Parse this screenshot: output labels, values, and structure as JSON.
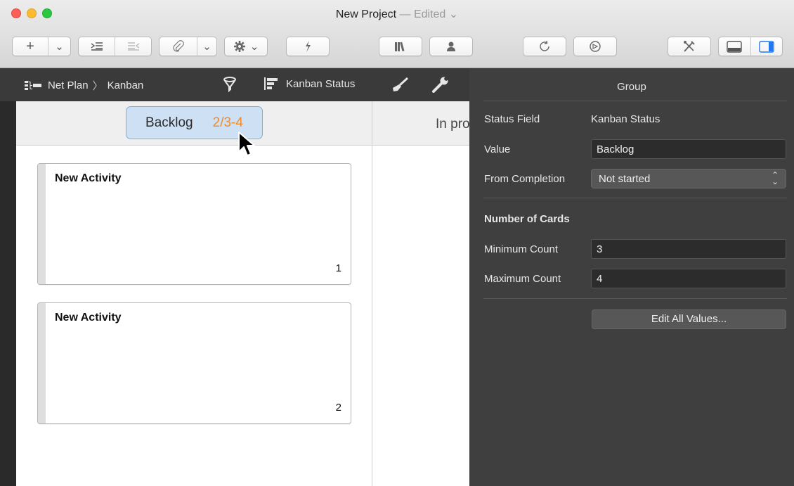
{
  "window": {
    "title": "New Project",
    "edited": "— Edited",
    "edited_chevron": "⌄"
  },
  "toolbar": {
    "add_label": "+",
    "add_menu": "⌄",
    "link_menu": "⌄",
    "action_menu": "⌄"
  },
  "header": {
    "breadcrumb_parent": "Net Plan",
    "breadcrumb_separator": "〉",
    "breadcrumb_current": "Kanban",
    "status_field_label": "Kanban Status"
  },
  "board": {
    "columns": [
      {
        "name": "Backlog",
        "count": "2/3-4"
      },
      {
        "name": "In progress"
      }
    ],
    "cards": [
      {
        "title": "New Activity",
        "number": "1"
      },
      {
        "title": "New Activity",
        "number": "2"
      }
    ]
  },
  "inspector": {
    "title": "Group",
    "status_field_label": "Status Field",
    "status_field_value": "Kanban Status",
    "value_label": "Value",
    "value_value": "Backlog",
    "completion_label": "From Completion",
    "completion_value": "Not started",
    "cards_section": "Number of Cards",
    "min_label": "Minimum Count",
    "min_value": "3",
    "max_label": "Maximum Count",
    "max_value": "4",
    "edit_button": "Edit All Values..."
  },
  "colors": {
    "count_accent": "#f08c2a",
    "selected_pill": "#cde0f4",
    "inspector_bg": "#3f3f3f"
  },
  "icons": [
    "outdent-icon",
    "indent-icon",
    "paperclip-icon",
    "gear-icon",
    "lightning-icon",
    "library-icon",
    "person-icon",
    "refresh-icon",
    "compass-icon",
    "tools-icon",
    "bottom-panel-icon",
    "side-panel-icon",
    "hierarchy-icon",
    "filter-icon",
    "gantt-icon",
    "brush-icon",
    "wrench-icon",
    "cursor-icon"
  ]
}
